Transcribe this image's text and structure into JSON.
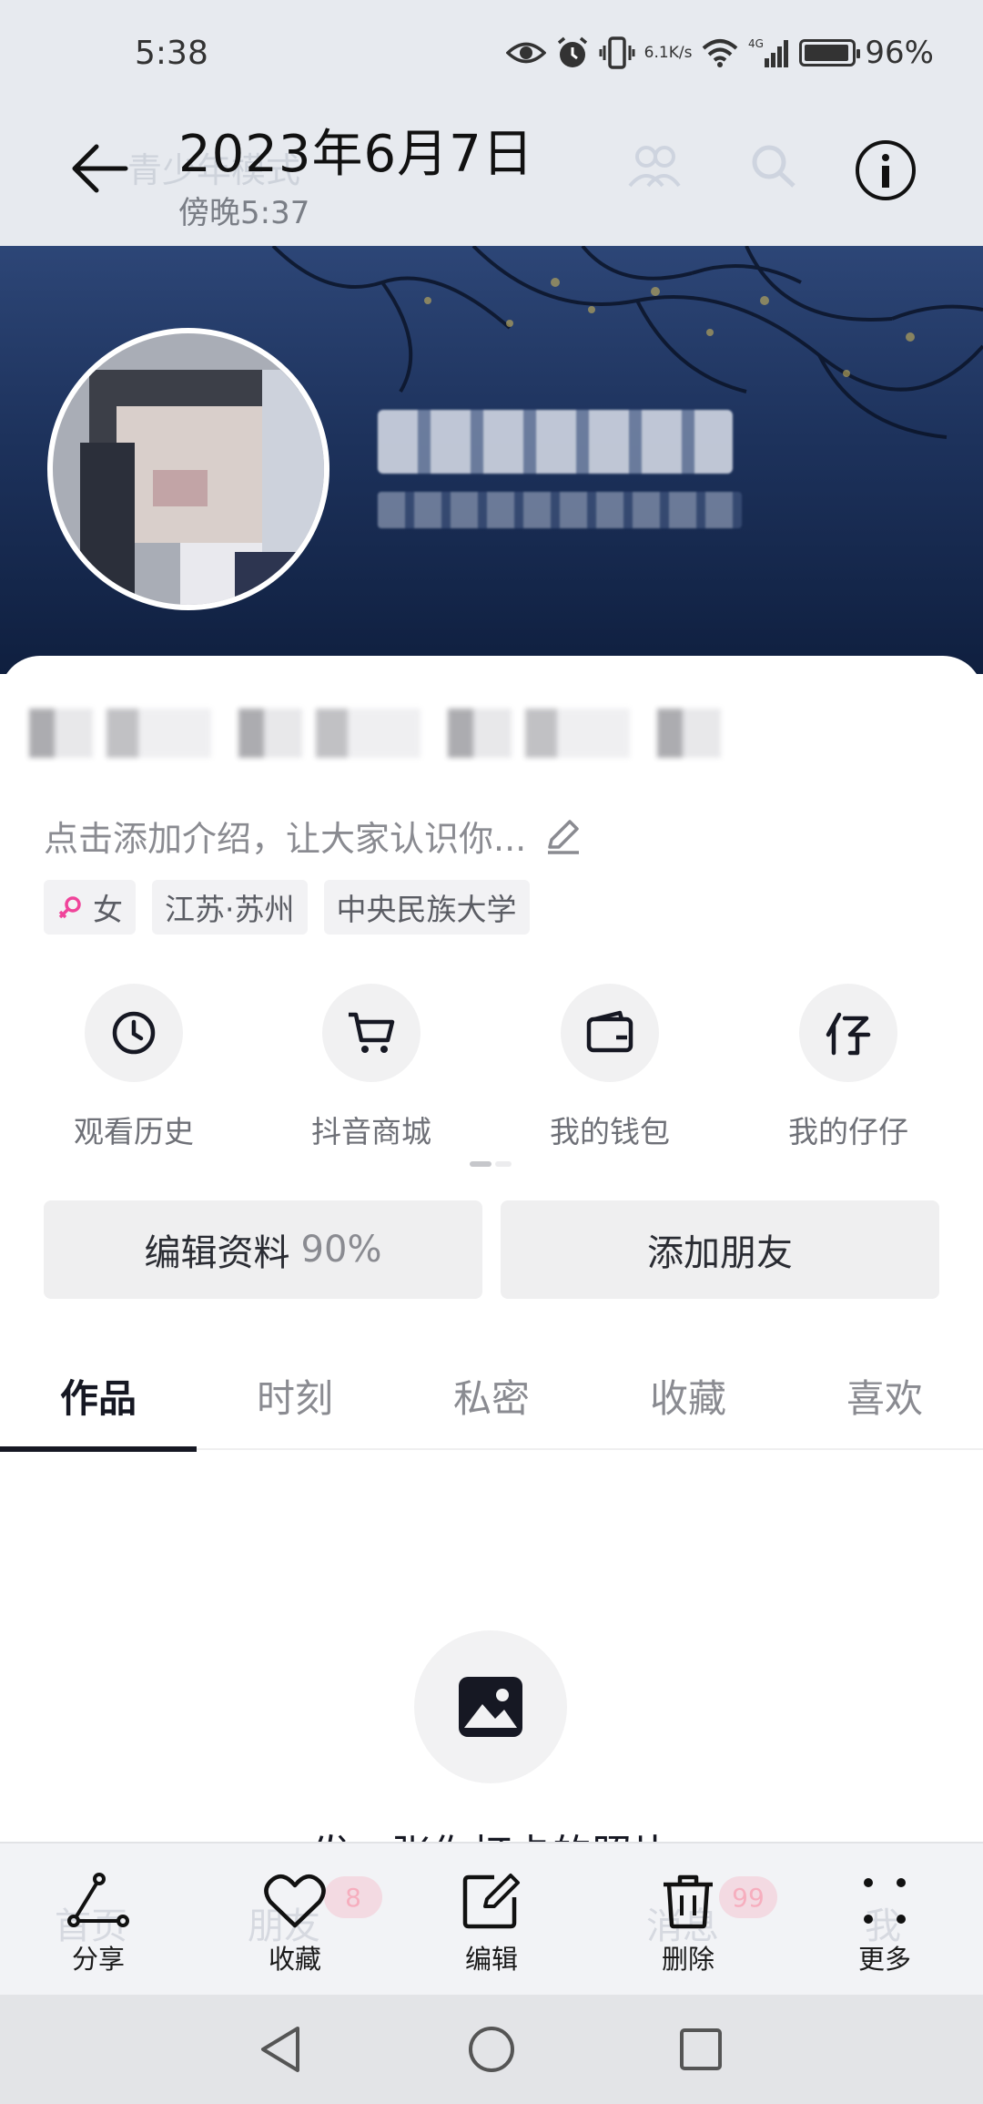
{
  "status_bar": {
    "time": "5:38",
    "net_speed_value": "6.1",
    "net_speed_unit": "K/s",
    "network_type": "4G",
    "battery": "96%",
    "icons": [
      "eye-icon",
      "alarm-icon",
      "vibrate-icon",
      "wifi-icon",
      "signal-icon",
      "battery-icon"
    ]
  },
  "header": {
    "title": "2023年6月7日",
    "subtitle": "傍晚5:37",
    "faint_underlay_text": "青少年模式"
  },
  "profile": {
    "bio_placeholder": "点击添加介绍，让大家认识你...",
    "tags": [
      {
        "icon": "female-icon",
        "label": "女"
      },
      {
        "label": "江苏·苏州"
      },
      {
        "label": "中央民族大学"
      }
    ]
  },
  "shortcuts": [
    {
      "icon": "clock-icon",
      "label": "观看历史"
    },
    {
      "icon": "cart-icon",
      "label": "抖音商城"
    },
    {
      "icon": "wallet-icon",
      "label": "我的钱包"
    },
    {
      "icon": "zaizai-icon",
      "label": "我的仔仔"
    }
  ],
  "buttons": {
    "edit_profile": "编辑资料",
    "edit_profile_progress": "90%",
    "add_friend": "添加朋友"
  },
  "tabs": [
    {
      "label": "作品",
      "active": true
    },
    {
      "label": "时刻",
      "active": false
    },
    {
      "label": "私密",
      "active": false
    },
    {
      "label": "收藏",
      "active": false
    },
    {
      "label": "喜欢",
      "active": false
    }
  ],
  "empty_state": {
    "icon": "image-icon",
    "text": "发一张你打卡的照片"
  },
  "action_bar": [
    {
      "icon": "share-icon",
      "label": "分享"
    },
    {
      "icon": "heart-icon",
      "label": "收藏"
    },
    {
      "icon": "edit-icon",
      "label": "编辑"
    },
    {
      "icon": "trash-icon",
      "label": "删除"
    },
    {
      "icon": "more-icon",
      "label": "更多"
    }
  ],
  "ghost_tabbar": {
    "labels": [
      "首页",
      "朋友",
      "消息",
      "我"
    ],
    "badge_friends": "8",
    "badge_messages": "99"
  },
  "colors": {
    "text_primary": "#161823",
    "text_secondary": "#8a8b91",
    "accent_pink": "#fe2c55",
    "chip_bg": "#f2f2f4",
    "cover_dark": "#0f1f3f"
  }
}
